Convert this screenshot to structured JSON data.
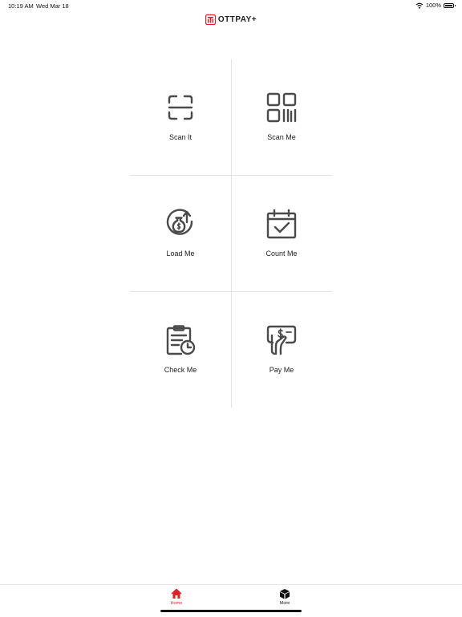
{
  "status_bar": {
    "time": "10:19 AM",
    "date": "Wed Mar 18",
    "battery": "100%"
  },
  "header": {
    "logo_text": "OTTPAY+"
  },
  "colors": {
    "accent": "#e01f26",
    "icon": "#4a4a4a",
    "divider": "#e3e3e3"
  },
  "menu": {
    "items": [
      {
        "label": "Scan It",
        "icon": "scan-frame-icon"
      },
      {
        "label": "Scan Me",
        "icon": "qr-code-icon"
      },
      {
        "label": "Load Me",
        "icon": "money-bag-up-icon"
      },
      {
        "label": "Count Me",
        "icon": "calendar-check-icon"
      },
      {
        "label": "Check Me",
        "icon": "clipboard-clock-icon"
      },
      {
        "label": "Pay Me",
        "icon": "hand-payment-icon"
      }
    ]
  },
  "tab_bar": {
    "home_label": "Home",
    "more_label": "More"
  }
}
